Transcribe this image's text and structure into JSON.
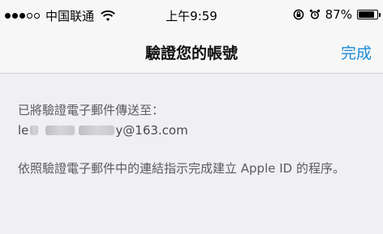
{
  "status_bar": {
    "carrier": "中国联通",
    "time": "上午9:59",
    "battery_percent": "87%",
    "battery_level": 0.87,
    "signal_bars_filled": 3,
    "signal_bars_total": 5,
    "icons": [
      "signal-dots-icon",
      "wifi-icon",
      "lock-rotation-icon",
      "alarm-icon",
      "battery-icon"
    ]
  },
  "nav": {
    "title": "驗證您的帳號",
    "done_label": "完成",
    "accent_color": "#1a8cd8"
  },
  "content": {
    "sent_label": "已將驗證電子郵件傳送至：",
    "email_visible_start": "le",
    "email_visible_end": "y@163.com",
    "instruction": "依照驗證電子郵件中的連結指示完成建立 Apple ID 的程序。"
  }
}
